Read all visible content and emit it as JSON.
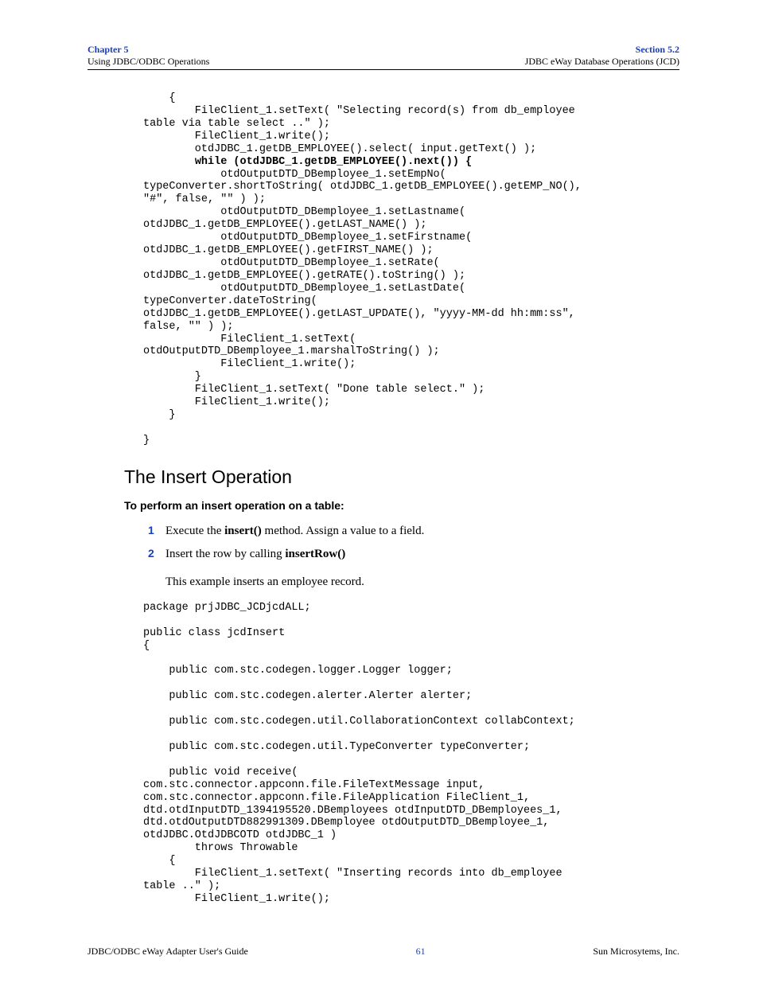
{
  "header": {
    "chapter": "Chapter 5",
    "chapter_sub": "Using JDBC/ODBC Operations",
    "section": "Section 5.2",
    "section_sub": "JDBC eWay Database Operations (JCD)"
  },
  "code1": {
    "l1": "    {",
    "l2": "        FileClient_1.setText( \"Selecting record(s) from db_employee ",
    "l3": "table via table select ..\" );",
    "l4": "        FileClient_1.write();",
    "l5": "        otdJDBC_1.getDB_EMPLOYEE().select( input.getText() );",
    "l6": "        ",
    "l6b": "while (otdJDBC_1.getDB_EMPLOYEE().next()) {",
    "l7": "            otdOutputDTD_DBemployee_1.setEmpNo( ",
    "l8": "typeConverter.shortToString( otdJDBC_1.getDB_EMPLOYEE().getEMP_NO(), ",
    "l9": "\"#\", false, \"\" ) );",
    "l10": "            otdOutputDTD_DBemployee_1.setLastname( ",
    "l11": "otdJDBC_1.getDB_EMPLOYEE().getLAST_NAME() );",
    "l12": "            otdOutputDTD_DBemployee_1.setFirstname( ",
    "l13": "otdJDBC_1.getDB_EMPLOYEE().getFIRST_NAME() );",
    "l14": "            otdOutputDTD_DBemployee_1.setRate( ",
    "l15": "otdJDBC_1.getDB_EMPLOYEE().getRATE().toString() );",
    "l16": "            otdOutputDTD_DBemployee_1.setLastDate( ",
    "l17": "typeConverter.dateToString( ",
    "l18": "otdJDBC_1.getDB_EMPLOYEE().getLAST_UPDATE(), \"yyyy-MM-dd hh:mm:ss\", ",
    "l19": "false, \"\" ) );",
    "l20": "            FileClient_1.setText( ",
    "l21": "otdOutputDTD_DBemployee_1.marshalToString() );",
    "l22": "            FileClient_1.write();",
    "l23": "        }",
    "l24": "        FileClient_1.setText( \"Done table select.\" );",
    "l25": "        FileClient_1.write();",
    "l26": "    }",
    "l27": "",
    "l28": "}"
  },
  "section_title": "The Insert Operation",
  "intro": "To perform an insert operation on a table:",
  "steps": {
    "s1a": "Execute the ",
    "s1b": "insert()",
    "s1c": " method. Assign a value to a field.",
    "s2a": "Insert the row by calling ",
    "s2b": "insertRow()"
  },
  "example": "This example inserts an employee record.",
  "code2": {
    "l1": "package prjJDBC_JCDjcdALL;",
    "l2": "",
    "l3": "public class jcdInsert",
    "l4": "{",
    "l5": "",
    "l6": "    public com.stc.codegen.logger.Logger logger;",
    "l7": "",
    "l8": "    public com.stc.codegen.alerter.Alerter alerter;",
    "l9": "",
    "l10": "    public com.stc.codegen.util.CollaborationContext collabContext;",
    "l11": "",
    "l12": "    public com.stc.codegen.util.TypeConverter typeConverter;",
    "l13": "",
    "l14": "    public void receive( ",
    "l15": "com.stc.connector.appconn.file.FileTextMessage input, ",
    "l16": "com.stc.connector.appconn.file.FileApplication FileClient_1, ",
    "l17": "dtd.otdInputDTD_1394195520.DBemployees otdInputDTD_DBemployees_1, ",
    "l18": "dtd.otdOutputDTD882991309.DBemployee otdOutputDTD_DBemployee_1, ",
    "l19": "otdJDBC.OtdJDBCOTD otdJDBC_1 )",
    "l20": "        throws Throwable",
    "l21": "    {",
    "l22": "        FileClient_1.setText( \"Inserting records into db_employee ",
    "l23": "table ..\" );",
    "l24": "        FileClient_1.write();"
  },
  "footer": {
    "title": "JDBC/ODBC eWay Adapter User's Guide",
    "page": "61",
    "company": "Sun Microsytems, Inc."
  }
}
